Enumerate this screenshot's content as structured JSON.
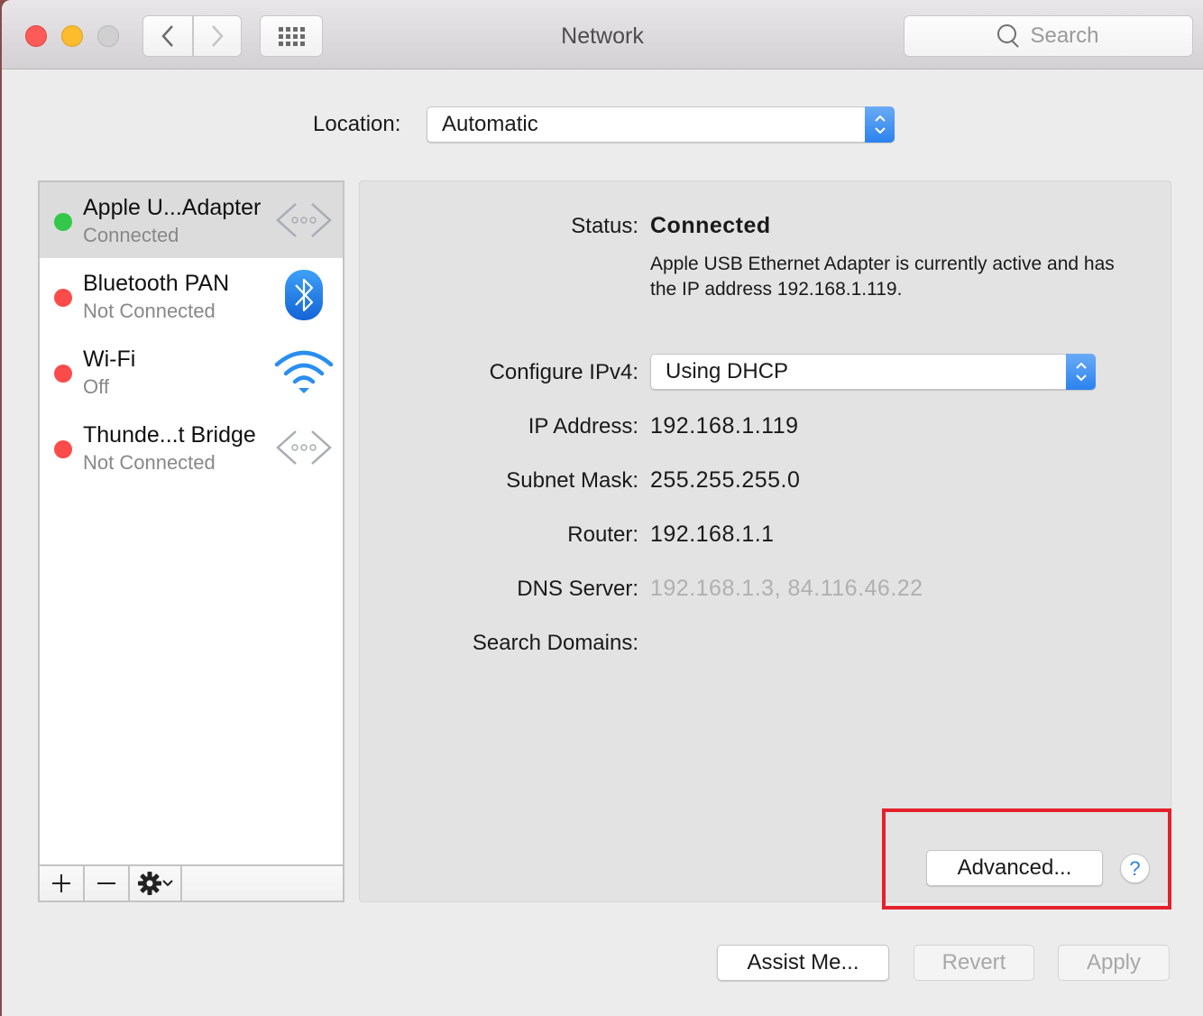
{
  "window": {
    "title": "Network",
    "search_placeholder": "Search",
    "nav": {
      "back": "‹",
      "forward": "›"
    }
  },
  "location": {
    "label": "Location:",
    "value": "Automatic"
  },
  "services": [
    {
      "name": "Apple U...Adapter",
      "status": "Connected",
      "status_color": "#34c84a",
      "icon": "ethernet-icon",
      "selected": true
    },
    {
      "name": "Bluetooth PAN",
      "status": "Not Connected",
      "status_color": "#fc4b4b",
      "icon": "bluetooth-icon",
      "selected": false
    },
    {
      "name": "Wi-Fi",
      "status": "Off",
      "status_color": "#fc4b4b",
      "icon": "wifi-icon",
      "selected": false
    },
    {
      "name": "Thunde...t Bridge",
      "status": "Not Connected",
      "status_color": "#fc4b4b",
      "icon": "ethernet-icon",
      "selected": false
    }
  ],
  "sidebar_toolbar": {
    "add": "+",
    "remove": "—",
    "gear": "⚙"
  },
  "detail": {
    "status_label": "Status:",
    "status_value": "Connected",
    "description": "Apple USB Ethernet Adapter is currently active and has the IP address 192.168.1.119.",
    "configure_label": "Configure IPv4:",
    "configure_value": "Using DHCP",
    "ip_label": "IP Address:",
    "ip_value": "192.168.1.119",
    "subnet_label": "Subnet Mask:",
    "subnet_value": "255.255.255.0",
    "router_label": "Router:",
    "router_value": "192.168.1.1",
    "dns_label": "DNS Server:",
    "dns_value": "192.168.1.3, 84.116.46.22",
    "search_domains_label": "Search Domains:",
    "search_domains_value": ""
  },
  "buttons": {
    "advanced": "Advanced...",
    "help": "?",
    "assist": "Assist Me...",
    "revert": "Revert",
    "apply": "Apply"
  },
  "colors": {
    "accent": "#2b82ee",
    "highlight_box": "#e4212b"
  }
}
